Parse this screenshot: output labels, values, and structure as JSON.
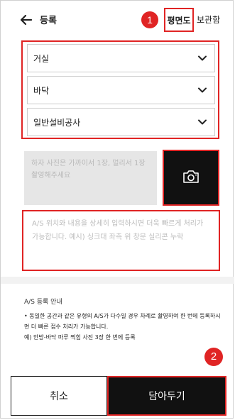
{
  "header": {
    "back_icon": "arrow-left-icon",
    "title": "등록",
    "badge1": "1",
    "plan_label": "평면도",
    "storage_label": "보관함"
  },
  "dropdowns": [
    {
      "value": "거실"
    },
    {
      "value": "바닥"
    },
    {
      "value": "일반설비공사"
    }
  ],
  "photo": {
    "hint": "하자 사진은 가까이서 1장, 멀리서 1장 촬영해주세요",
    "camera_icon": "camera-icon"
  },
  "description": {
    "placeholder": "A/S 위치와 내용을 상세히 입력하시면 더욱 빠르게 처리가 가능합니다. 예시) 싱크대 좌측 위 창문 실리콘 누락"
  },
  "info": {
    "title": "A/S 등록 안내",
    "body": "• 동일한 공간과 같은 유형의 A/S가 다수일 경우 차례로 촬영하여 한 번에 등록하시면 더 빠른 접수 처리가 가능합니다.",
    "example": "예) 안방-바닥 마루 찍힘 사진 3장 한 번에 등록"
  },
  "footer": {
    "badge2": "2",
    "cancel_label": "취소",
    "save_label": "담아두기"
  },
  "colors": {
    "highlight": "#e02424",
    "dark": "#111111"
  }
}
